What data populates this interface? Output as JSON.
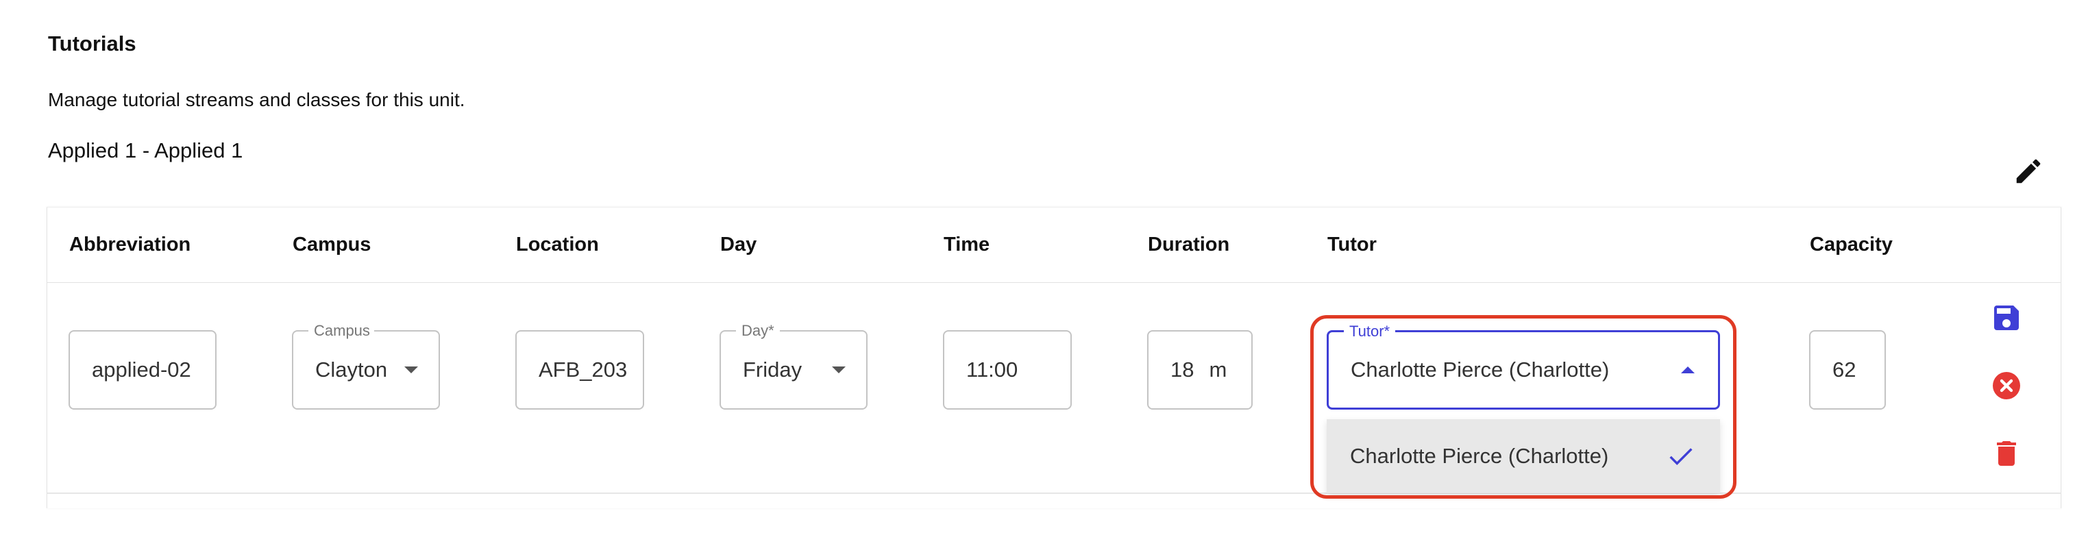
{
  "header": {
    "title": "Tutorials",
    "description": "Manage tutorial streams and classes for this unit.",
    "stream_title": "Applied 1 - Applied 1"
  },
  "table": {
    "columns": [
      "Abbreviation",
      "Campus",
      "Location",
      "Day",
      "Time",
      "Duration",
      "Tutor",
      "Capacity"
    ],
    "row": {
      "abbreviation": "applied-02",
      "campus_legend": "Campus",
      "campus": "Clayton",
      "location": "AFB_203",
      "day_legend": "Day*",
      "day": "Friday",
      "time": "11:00",
      "duration_value": "18",
      "duration_unit": "m",
      "tutor_legend": "Tutor*",
      "tutor": "Charlotte Pierce (Charlotte)",
      "capacity": "62"
    }
  },
  "dropdown": {
    "options": [
      {
        "label": "Charlotte Pierce (Charlotte)",
        "selected": true
      }
    ]
  },
  "icons": {
    "edit": "pencil-icon",
    "save": "save-icon",
    "cancel": "cancel-icon",
    "delete": "trash-icon"
  },
  "colors": {
    "accent": "#3f3fd6",
    "danger": "#e53935",
    "highlight": "#e03a24"
  }
}
